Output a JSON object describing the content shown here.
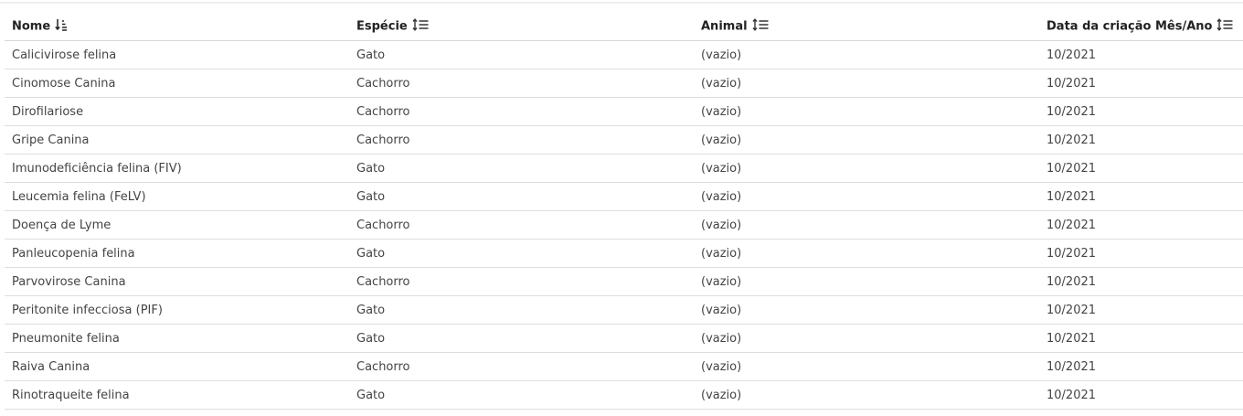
{
  "table": {
    "columns": [
      {
        "label": "Nome",
        "sort_icon": "sort-ascending-icon"
      },
      {
        "label": "Espécie",
        "sort_icon": "sort-icon"
      },
      {
        "label": "Animal",
        "sort_icon": "sort-icon"
      },
      {
        "label": "Data da criação Mês/Ano",
        "sort_icon": "sort-icon"
      }
    ],
    "rows": [
      [
        "Calicivirose felina",
        "Gato",
        "(vazio)",
        "10/2021"
      ],
      [
        "Cinomose Canina",
        "Cachorro",
        "(vazio)",
        "10/2021"
      ],
      [
        "Dirofilariose",
        "Cachorro",
        "(vazio)",
        "10/2021"
      ],
      [
        "Gripe Canina",
        "Cachorro",
        "(vazio)",
        "10/2021"
      ],
      [
        "Imunodeficiência felina (FIV)",
        "Gato",
        "(vazio)",
        "10/2021"
      ],
      [
        "Leucemia felina (FeLV)",
        "Gato",
        "(vazio)",
        "10/2021"
      ],
      [
        "Doença de Lyme",
        "Cachorro",
        "(vazio)",
        "10/2021"
      ],
      [
        "Panleucopenia felina",
        "Gato",
        "(vazio)",
        "10/2021"
      ],
      [
        "Parvovirose Canina",
        "Cachorro",
        "(vazio)",
        "10/2021"
      ],
      [
        "Peritonite infecciosa (PIF)",
        "Gato",
        "(vazio)",
        "10/2021"
      ],
      [
        "Pneumonite felina",
        "Gato",
        "(vazio)",
        "10/2021"
      ],
      [
        "Raiva Canina",
        "Cachorro",
        "(vazio)",
        "10/2021"
      ],
      [
        "Rinotraqueite felina",
        "Gato",
        "(vazio)",
        "10/2021"
      ]
    ]
  }
}
